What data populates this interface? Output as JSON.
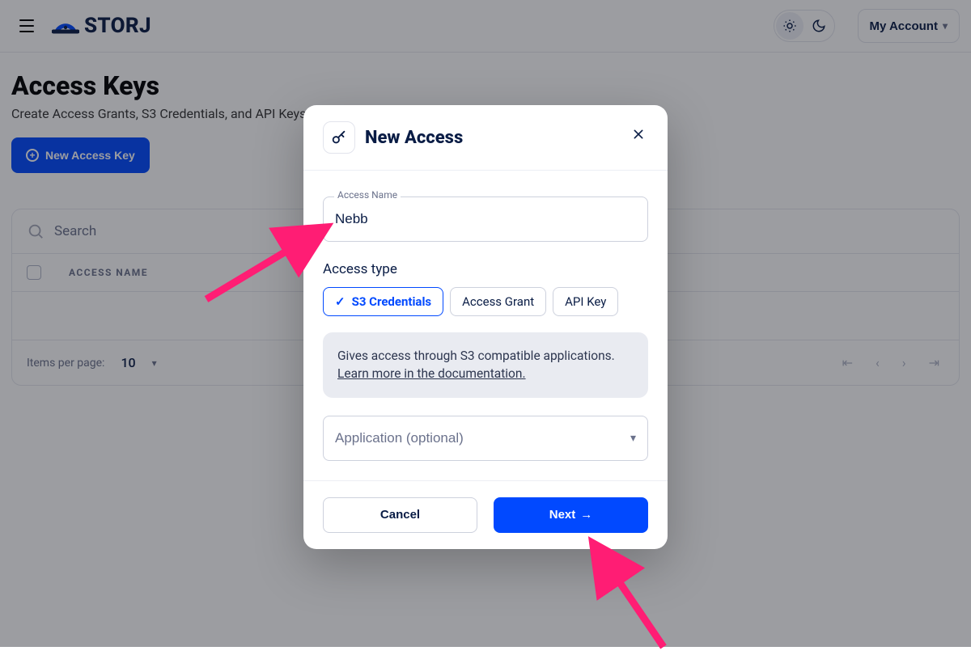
{
  "header": {
    "brand": "STORJ",
    "account_label": "My Account"
  },
  "page": {
    "title": "Access Keys",
    "subtitle": "Create Access Grants, S3 Credentials, and API Keys.",
    "new_key_label": "New Access Key",
    "search_placeholder": "Search",
    "columns": {
      "name": "ACCESS NAME"
    },
    "pager": {
      "label": "Items per page:",
      "value": "10"
    }
  },
  "modal": {
    "title": "New Access",
    "access_name_label": "Access Name",
    "access_name_value": "Nebb",
    "access_type_label": "Access type",
    "chips": {
      "s3": "S3 Credentials",
      "grant": "Access Grant",
      "api": "API Key"
    },
    "info_text": "Gives access through S3 compatible applications.",
    "info_link": "Learn more in the documentation.",
    "application_placeholder": "Application (optional)",
    "cancel_label": "Cancel",
    "next_label": "Next"
  }
}
